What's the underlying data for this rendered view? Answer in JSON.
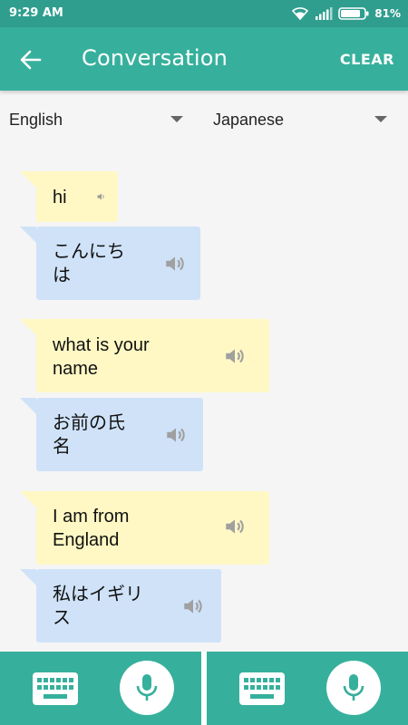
{
  "status_bar": {
    "time": "9:29 AM",
    "battery_percent": "81%",
    "icons": [
      "wifi-icon",
      "signal-icon",
      "battery-icon"
    ]
  },
  "app_bar": {
    "back_icon": "arrow-back-icon",
    "title": "Conversation",
    "clear_label": "CLEAR"
  },
  "languages": {
    "source": "English",
    "target": "Japanese"
  },
  "messages": [
    {
      "side": "source",
      "color": "yellow",
      "lines": [
        "hi"
      ]
    },
    {
      "side": "target",
      "color": "blue",
      "lines": [
        "こんにち",
        "は"
      ]
    },
    {
      "side": "source",
      "color": "yellow",
      "lines": [
        "what is your",
        "name"
      ]
    },
    {
      "side": "target",
      "color": "blue",
      "lines": [
        "お前の氏",
        "名"
      ]
    },
    {
      "side": "source",
      "color": "yellow",
      "lines": [
        "I am from",
        "England"
      ]
    },
    {
      "side": "target",
      "color": "blue",
      "lines": [
        "私はイギリ",
        "ス"
      ]
    }
  ],
  "colors": {
    "status_bar": "#2f9e8f",
    "app_bar": "#36b09c",
    "source_bubble": "#fff8c4",
    "target_bubble": "#cfe2f8",
    "mic_icon": "#36b09c"
  },
  "bottom_bar": {
    "left": {
      "keyboard_icon": "keyboard-icon",
      "mic_icon": "microphone-icon"
    },
    "right": {
      "keyboard_icon": "keyboard-icon",
      "mic_icon": "microphone-icon"
    }
  }
}
